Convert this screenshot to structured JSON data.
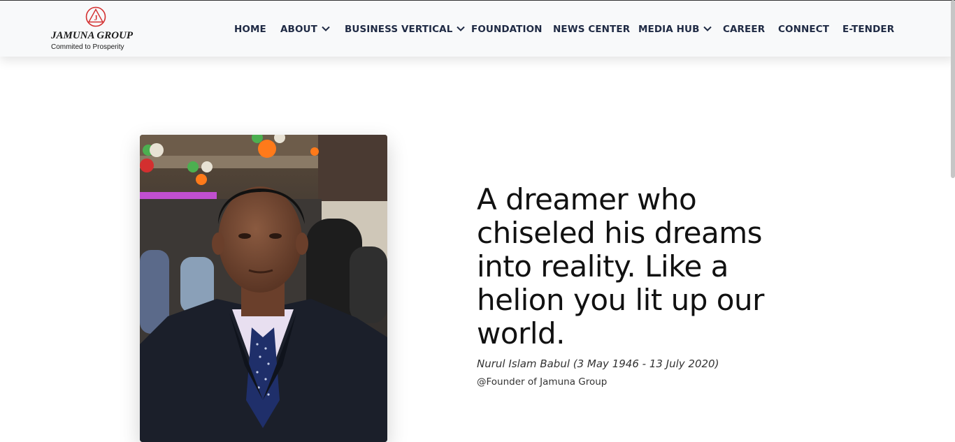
{
  "header": {
    "logo": {
      "name": "JAMUNA GROUP",
      "tagline": "Commited to Prosperity",
      "mark_letter": "J",
      "mark_color": "#d32f2f"
    },
    "nav": [
      {
        "label": "HOME",
        "dropdown": false
      },
      {
        "label": "ABOUT",
        "dropdown": true
      },
      {
        "label": "BUSINESS VERTICAL",
        "dropdown": true
      },
      {
        "label": "FOUNDATION",
        "dropdown": false
      },
      {
        "label": "NEWS CENTER",
        "dropdown": false
      },
      {
        "label": "MEDIA HUB",
        "dropdown": true
      },
      {
        "label": "CAREER",
        "dropdown": false
      },
      {
        "label": "CONNECT",
        "dropdown": false
      },
      {
        "label": "E-TENDER",
        "dropdown": false
      }
    ]
  },
  "hero": {
    "quote_lines": [
      "A dreamer who",
      "chiseled his dreams",
      "into reality. Like a",
      "helion you lit up our",
      "world."
    ],
    "attribution": "Nurul Islam Babul (3 May 1946 - 13 July 2020)",
    "role": "@Founder of Jamuna Group"
  },
  "colors": {
    "nav_text": "#1f2a44",
    "navbar_bg": "#f8f9fa",
    "brand_red": "#d32f2f"
  }
}
